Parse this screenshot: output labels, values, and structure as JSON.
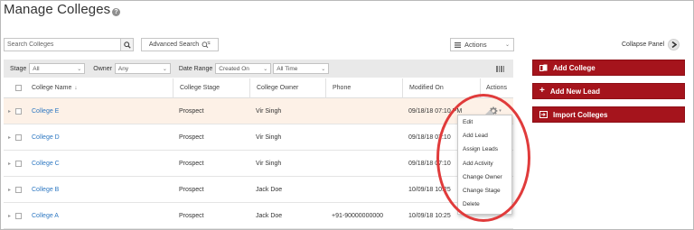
{
  "page": {
    "title": "Manage Colleges"
  },
  "toolbar": {
    "search_placeholder": "Search Colleges",
    "advanced_search_label": "Advanced Search",
    "actions_label": "Actions"
  },
  "filters": {
    "stage_label": "Stage",
    "stage_value": "All",
    "owner_label": "Owner",
    "owner_value": "Any",
    "date_range_label": "Date Range",
    "date_field_value": "Created On",
    "date_period_value": "All Time"
  },
  "table": {
    "columns": [
      "College Name",
      "College Stage",
      "College Owner",
      "Phone",
      "Modified On",
      "Actions"
    ],
    "rows": [
      {
        "name": "College E",
        "stage": "Prospect",
        "owner": "Vir Singh",
        "phone": "",
        "modified": "09/18/18 07:10 PM"
      },
      {
        "name": "College D",
        "stage": "Prospect",
        "owner": "Vir Singh",
        "phone": "",
        "modified": "09/18/18 07:10"
      },
      {
        "name": "College C",
        "stage": "Prospect",
        "owner": "Vir Singh",
        "phone": "",
        "modified": "09/18/18 07:10"
      },
      {
        "name": "College B",
        "stage": "Prospect",
        "owner": "Jack Doe",
        "phone": "",
        "modified": "10/09/18 10:25"
      },
      {
        "name": "College A",
        "stage": "Prospect",
        "owner": "Jack Doe",
        "phone": "+91-90000000000",
        "modified": "10/09/18 10:25"
      }
    ]
  },
  "action_menu": {
    "items": [
      "Edit",
      "Add Lead",
      "Assign Leads",
      "Add Activity",
      "Change Owner",
      "Change Stage",
      "Delete"
    ]
  },
  "side_panel": {
    "collapse_label": "Collapse Panel",
    "buttons": [
      "Add College",
      "Add New Lead",
      "Import Colleges"
    ]
  },
  "colors": {
    "brand_red": "#a5141c",
    "link_blue": "#2e78c2",
    "highlight_row": "#fdf1e7",
    "annotation_ring": "#e03b3b"
  }
}
